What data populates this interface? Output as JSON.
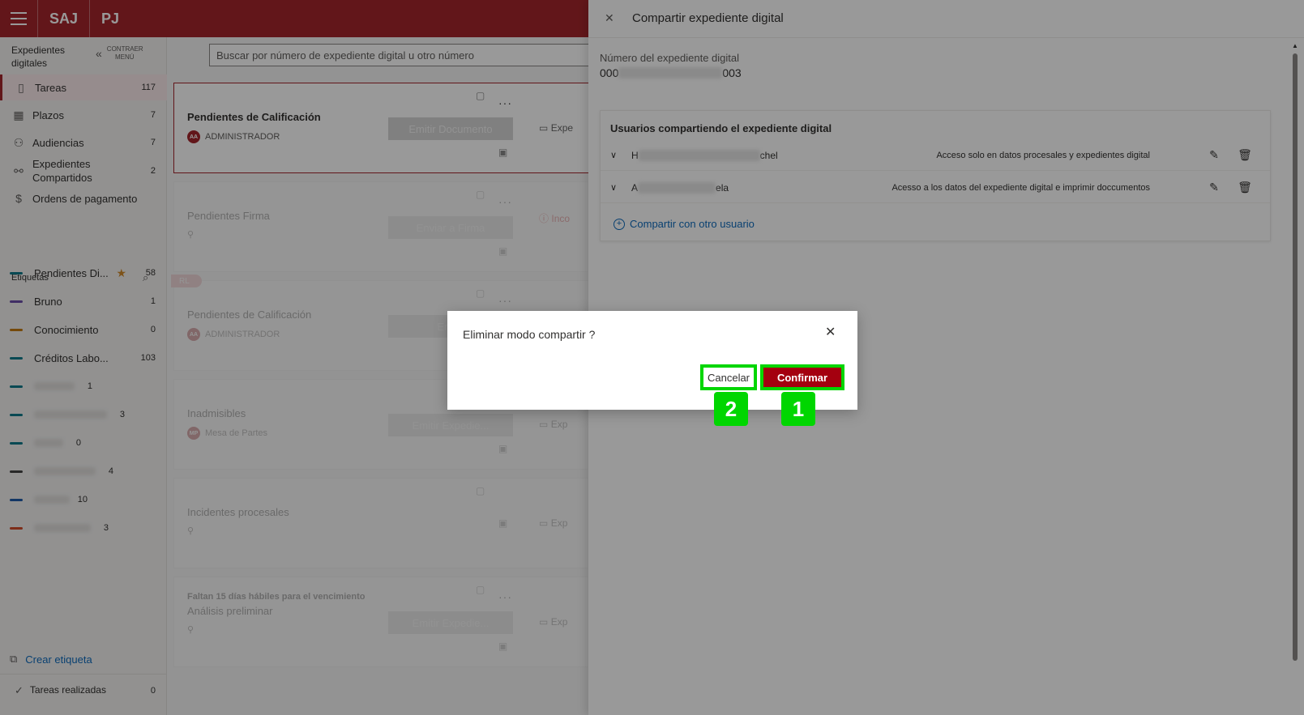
{
  "app": {
    "brand": "SAJ",
    "module": "PJ"
  },
  "sidebar": {
    "heading": "Expedientes digitales",
    "collapse_label": "CONTRAER MENÚ",
    "items": [
      {
        "label": "Tareas",
        "count": "117",
        "icon": "tasks-icon"
      },
      {
        "label": "Plazos",
        "count": "7",
        "icon": "calendar-icon"
      },
      {
        "label": "Audiencias",
        "count": "7",
        "icon": "people-icon"
      },
      {
        "label": "Expedientes Compartidos",
        "count": "2",
        "icon": "shared-icon"
      },
      {
        "label": "Ordens de pagamento",
        "count": "",
        "icon": "dollar-icon"
      }
    ],
    "tags_label": "Etiquetas",
    "tags": [
      {
        "label": "Pendientes Di...",
        "count": "58",
        "color": "#0f7b8a",
        "starred": true
      },
      {
        "label": "Bruno",
        "count": "1",
        "color": "#6b4ea8"
      },
      {
        "label": "Conocimiento",
        "count": "0",
        "color": "#c47a12"
      },
      {
        "label": "Créditos Labo...",
        "count": "103",
        "color": "#0f7b8a"
      },
      {
        "label": "",
        "count": "1",
        "color": "#0f7b8a"
      },
      {
        "label": "",
        "count": "3",
        "color": "#0f7b8a"
      },
      {
        "label": "",
        "count": "0",
        "color": "#0f7b8a"
      },
      {
        "label": "",
        "count": "4",
        "color": "#444444"
      },
      {
        "label": "",
        "count": "10",
        "color": "#1e5aa8"
      },
      {
        "label": "",
        "count": "3",
        "color": "#d14b2b"
      }
    ],
    "create_tag": "Crear etiqueta",
    "done_tasks": {
      "label": "Tareas realizadas",
      "count": "0"
    }
  },
  "main": {
    "search_placeholder": "Buscar por número de expediente digital u otro número",
    "cards": [
      {
        "title": "Pendientes de Calificación",
        "user": "ADMINISTRADOR",
        "initials": "AA",
        "button": "Emitir Documento",
        "side": "Expe"
      },
      {
        "title": "Pendientes Firma",
        "user": "",
        "button": "Enviar a Firma",
        "side": "Inco"
      },
      {
        "title": "Pendientes de Calificación",
        "user": "ADMINISTRADOR",
        "initials": "AA",
        "button": "Emitir",
        "ribbon": "RL"
      },
      {
        "title": "Inadmisibles",
        "user": "Mesa de Partes",
        "initials": "MP",
        "button": "Emitir Expedie...",
        "side": "Exp"
      },
      {
        "title": "Incidentes procesales",
        "user": "",
        "button": "",
        "side": "Exp"
      },
      {
        "title": "Análisis preliminar",
        "note": "Faltan 15 días hábiles para el vencimiento",
        "user": "",
        "button": "Emitir Expedie...",
        "side": "Exp"
      }
    ]
  },
  "panel": {
    "title": "Compartir expediente digital",
    "number_label": "Número del expediente digital",
    "number_prefix": "000",
    "number_suffix": "003",
    "users_title": "Usuarios compartiendo el expediente digital",
    "users": [
      {
        "name_start": "H",
        "name_end": "chel",
        "access": "Acceso solo en datos procesales y expedientes digital"
      },
      {
        "name_start": "A",
        "name_end": "ela",
        "access": "Acesso a los datos del expediente digital e imprimir doccumentos"
      }
    ],
    "share_more": "Compartir con otro usuario"
  },
  "dialog": {
    "title": "Eliminar modo compartir ?",
    "cancel": "Cancelar",
    "confirm": "Confirmar",
    "marker_cancel": "2",
    "marker_confirm": "1"
  },
  "colors": {
    "brand": "#a4262c",
    "confirm": "#a4000f",
    "highlight": "#00d600",
    "link": "#0f6cbd"
  }
}
